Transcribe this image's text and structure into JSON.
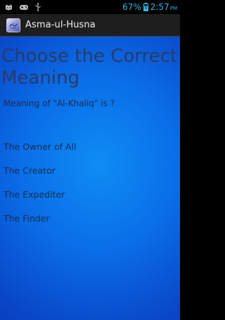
{
  "status_bar": {
    "battery_percent": "67%",
    "time": "2:57",
    "ampm": "PM",
    "left_icons": [
      "cat-notification-icon",
      "gamepad-notification-icon",
      "usb-icon"
    ],
    "right_icons": [
      "battery-icon"
    ],
    "accent_color": "#33b5e5"
  },
  "action_bar": {
    "title": "Asma-ul-Husna",
    "icon": "app-calligraphy-icon"
  },
  "quiz": {
    "heading": "Choose the Correct Meaning",
    "question": "Meaning of \"Al-Khaliq\" is ?",
    "options": [
      "The Owner of All",
      "The Creator",
      "The Expediter",
      "The Finder"
    ]
  },
  "colors": {
    "background_center": "#0e8cf4",
    "background_edge": "#0a2fa8",
    "text": "#1b2a4e"
  }
}
